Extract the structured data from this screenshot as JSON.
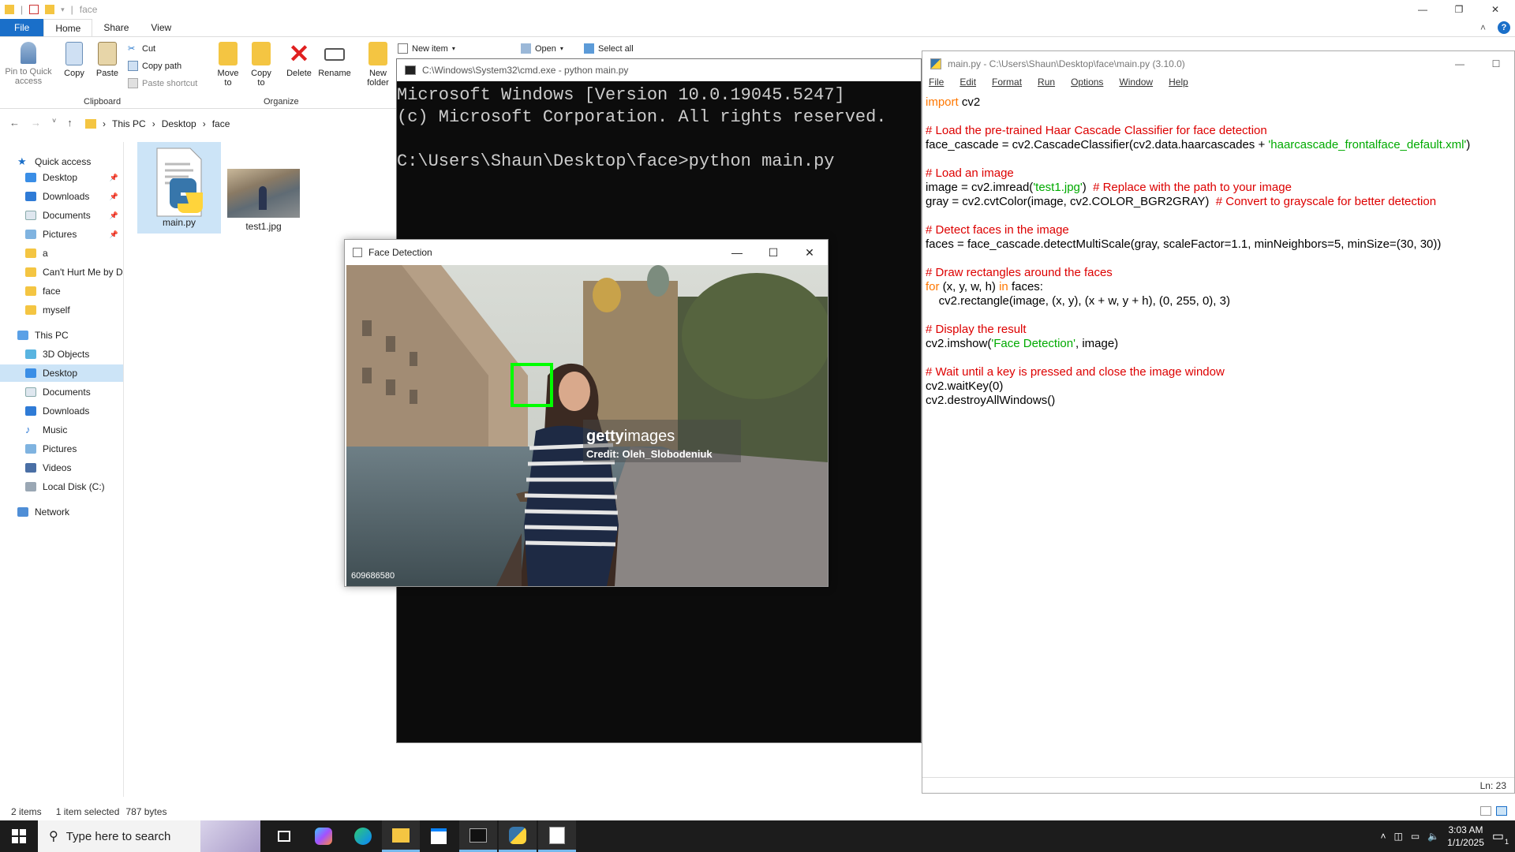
{
  "explorer": {
    "title": "face",
    "tabs": [
      "File",
      "Home",
      "Share",
      "View"
    ],
    "ribbon": {
      "pin": "Pin to Quick access",
      "copy": "Copy",
      "paste": "Paste",
      "cut": "Cut",
      "copy_path": "Copy path",
      "paste_shortcut": "Paste shortcut",
      "clipboard_group": "Clipboard",
      "move_to": "Move to",
      "copy_to": "Copy to",
      "delete": "Delete",
      "rename": "Rename",
      "organize_group": "Organize",
      "new_folder": "New folder",
      "new_item": "New item",
      "open": "Open",
      "select_all": "Select all"
    },
    "breadcrumb": [
      "This PC",
      "Desktop",
      "face"
    ],
    "sidebar": {
      "quick_access": "Quick access",
      "quick_items": [
        {
          "label": "Desktop",
          "pinned": true
        },
        {
          "label": "Downloads",
          "pinned": true
        },
        {
          "label": "Documents",
          "pinned": true
        },
        {
          "label": "Pictures",
          "pinned": true
        },
        {
          "label": "a",
          "pinned": false
        },
        {
          "label": "Can't Hurt Me by D",
          "pinned": false
        },
        {
          "label": "face",
          "pinned": false
        },
        {
          "label": "myself",
          "pinned": false
        }
      ],
      "this_pc": "This PC",
      "pc_items": [
        "3D Objects",
        "Desktop",
        "Documents",
        "Downloads",
        "Music",
        "Pictures",
        "Videos",
        "Local Disk (C:)"
      ],
      "network": "Network"
    },
    "files": [
      {
        "name": "main.py",
        "icon": "python-file-icon"
      },
      {
        "name": "test1.jpg",
        "icon": "image-thumbnail"
      }
    ],
    "status": {
      "items": "2 items",
      "selected": "1 item selected",
      "size": "787 bytes"
    }
  },
  "cmd": {
    "title": "C:\\Windows\\System32\\cmd.exe - python  main.py",
    "lines": [
      "Microsoft Windows [Version 10.0.19045.5247]",
      "(c) Microsoft Corporation. All rights reserved.",
      "",
      "C:\\Users\\Shaun\\Desktop\\face>python main.py"
    ]
  },
  "idle": {
    "title": "main.py - C:\\Users\\Shaun\\Desktop\\face\\main.py (3.10.0)",
    "menu": [
      "File",
      "Edit",
      "Format",
      "Run",
      "Options",
      "Window",
      "Help"
    ],
    "status": "Ln: 23"
  },
  "face_window": {
    "title": "Face Detection",
    "watermark_brand_a": "getty",
    "watermark_brand_b": "images",
    "watermark_credit": "Credit: Oleh_Slobodeniuk",
    "image_id": "609686580",
    "box_color": "#00ff00"
  },
  "taskbar": {
    "search_placeholder": "Type here to search",
    "time": "3:03 AM",
    "date": "1/1/2025",
    "notification_count": "1"
  }
}
